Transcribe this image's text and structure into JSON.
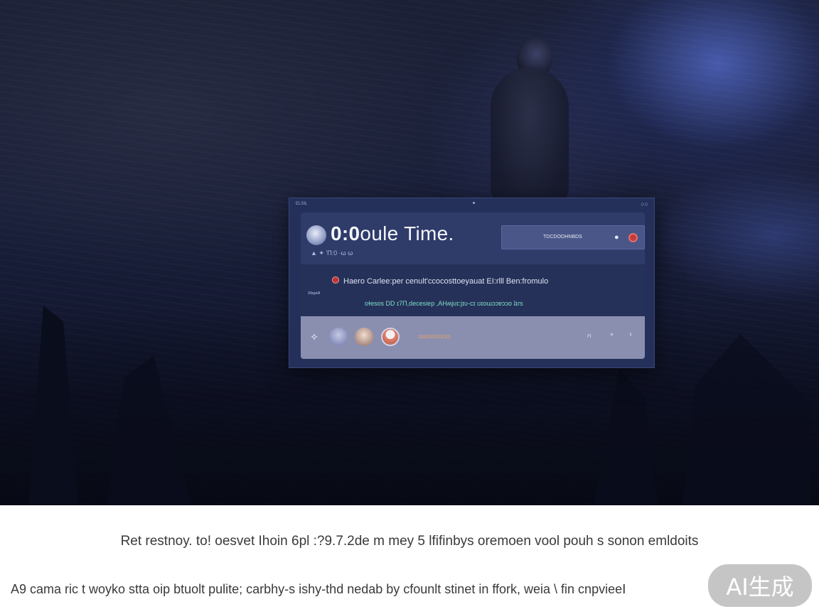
{
  "window": {
    "titlebar_left": "ELSIL",
    "titlebar_right": "○○"
  },
  "header": {
    "title_bold": "0:0",
    "title_rest": "oule Time.",
    "subtitle": "▲ ✦ 'Π:0 ·ω ω",
    "search_text": "TDCDOOHNBDS",
    "mic_icon": "🎤-icon"
  },
  "info": {
    "alert_text": "Haero Carlee:per cenult'ccocosttoeyauat EI:rlll Ben:fromulo",
    "side_label": "ϩlbɡʍlll",
    "sub_text": "oɫesos  DD ɪ7Π,decesiep ,AНʍjʋɪ:jɪʋ-cɪ ʊɪoɯɔɔɐɔɔo ʇɪɾs"
  },
  "bottom": {
    "tag_text": "ɔooɔɪɪɪɛɪɪɔɪɔ",
    "ctrl1": "⊓",
    "ctrl2": "ᴴ",
    "ctrl3": "ᴵᴵ"
  },
  "caption": {
    "line1": "Ret restnoy. to! oesvet Ihoin 6pl :?9.7.2de m mey  5 lfifinbys oremoen vool pouh s sonon emldoits",
    "line2": "A9 cama ric t woyko stta oip btuolt pulite; carbhy-s ishy-thd nedab  by cfounlt stinet in ffork, weia  \\ fin  cnpvieeꓲ "
  },
  "badge": {
    "label": "AI生成"
  },
  "colors": {
    "window_bg": "#25305a",
    "header_bg": "#2f3b69",
    "accent_red": "#c83a3a",
    "accent_teal": "#7fe0c8",
    "accent_orange": "#e7a268"
  }
}
